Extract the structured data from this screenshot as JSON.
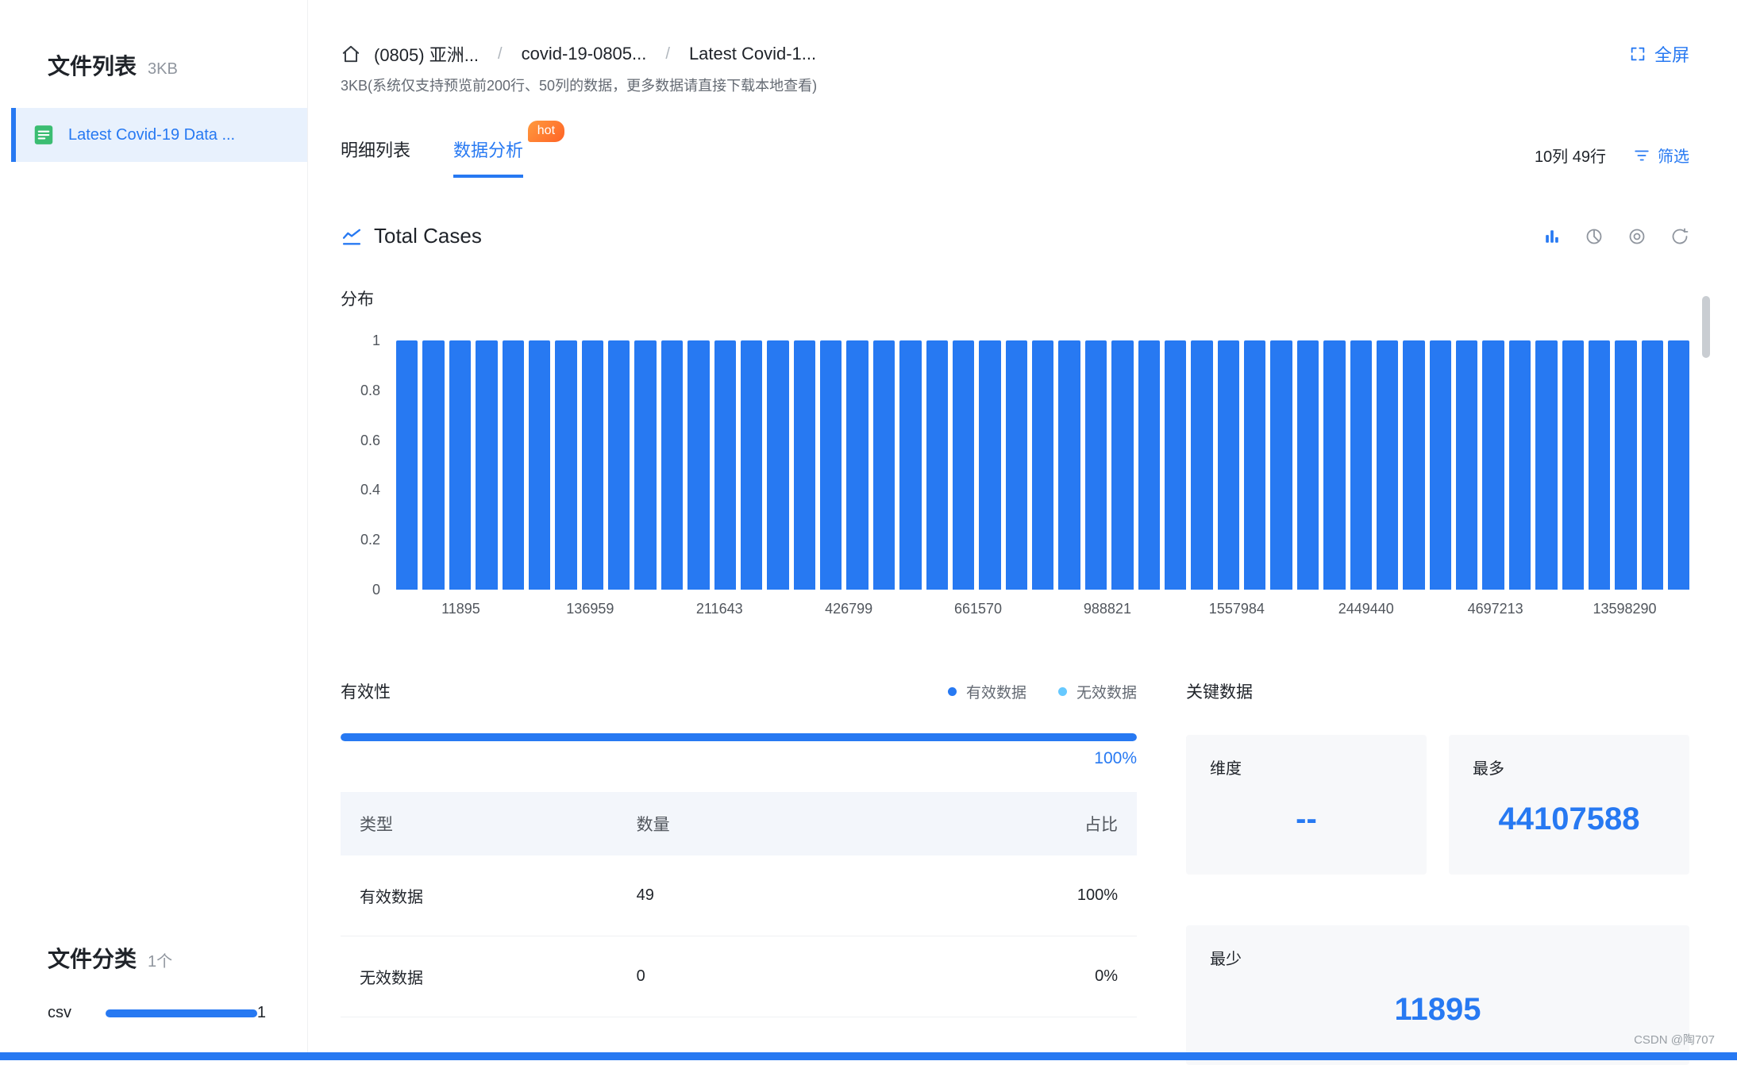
{
  "accent_color": "#2779f2",
  "sidebar": {
    "title": "文件列表",
    "size": "3KB",
    "file_name": "Latest Covid-19 Data ...",
    "category_title": "文件分类",
    "category_count": "1个",
    "category": {
      "label": "csv",
      "count": "1"
    }
  },
  "header": {
    "breadcrumb": [
      {
        "label": "(0805) 亚洲..."
      },
      {
        "label": "covid-19-0805..."
      },
      {
        "label": "Latest Covid-1..."
      }
    ],
    "subtitle": "3KB(系统仅支持预览前200行、50列的数据，更多数据请直接下载本地查看)",
    "fullscreen": "全屏"
  },
  "tabs": {
    "detail": "明细列表",
    "analysis": "数据分析",
    "hot": "hot",
    "meta": "10列 49行",
    "filter": "筛选"
  },
  "chart_section": {
    "title": "Total Cases",
    "subtitle": "分布"
  },
  "chart_data": {
    "type": "bar",
    "title": "Total Cases",
    "subtitle": "分布",
    "x_tick_labels": [
      "11895",
      "136959",
      "211643",
      "426799",
      "661570",
      "988821",
      "1557984",
      "2449440",
      "4697213",
      "13598290"
    ],
    "y_tick_labels": [
      "1",
      "0.8",
      "0.6",
      "0.4",
      "0.2",
      "0"
    ],
    "ylim": [
      0,
      1
    ],
    "values": [
      1,
      1,
      1,
      1,
      1,
      1,
      1,
      1,
      1,
      1,
      1,
      1,
      1,
      1,
      1,
      1,
      1,
      1,
      1,
      1,
      1,
      1,
      1,
      1,
      1,
      1,
      1,
      1,
      1,
      1,
      1,
      1,
      1,
      1,
      1,
      1,
      1,
      1,
      1,
      1,
      1,
      1,
      1,
      1,
      1,
      1,
      1,
      1,
      1
    ],
    "bar_color": "#2779f2",
    "grid": false,
    "legend_position": "none"
  },
  "validity": {
    "title": "有效性",
    "legend": [
      {
        "label": "有效数据",
        "color": "#2779f2"
      },
      {
        "label": "无效数据",
        "color": "#66c9ff"
      }
    ],
    "percent": "100%",
    "table": {
      "headers": [
        "类型",
        "数量",
        "占比"
      ],
      "rows": [
        [
          "有效数据",
          "49",
          "100%"
        ],
        [
          "无效数据",
          "0",
          "0%"
        ]
      ]
    }
  },
  "key_data": {
    "title": "关键数据",
    "cards": [
      {
        "label": "维度",
        "value": "--"
      },
      {
        "label": "最多",
        "value": "44107588"
      },
      {
        "label": "最少",
        "value": "11895"
      }
    ]
  },
  "watermark": "CSDN @陶707"
}
